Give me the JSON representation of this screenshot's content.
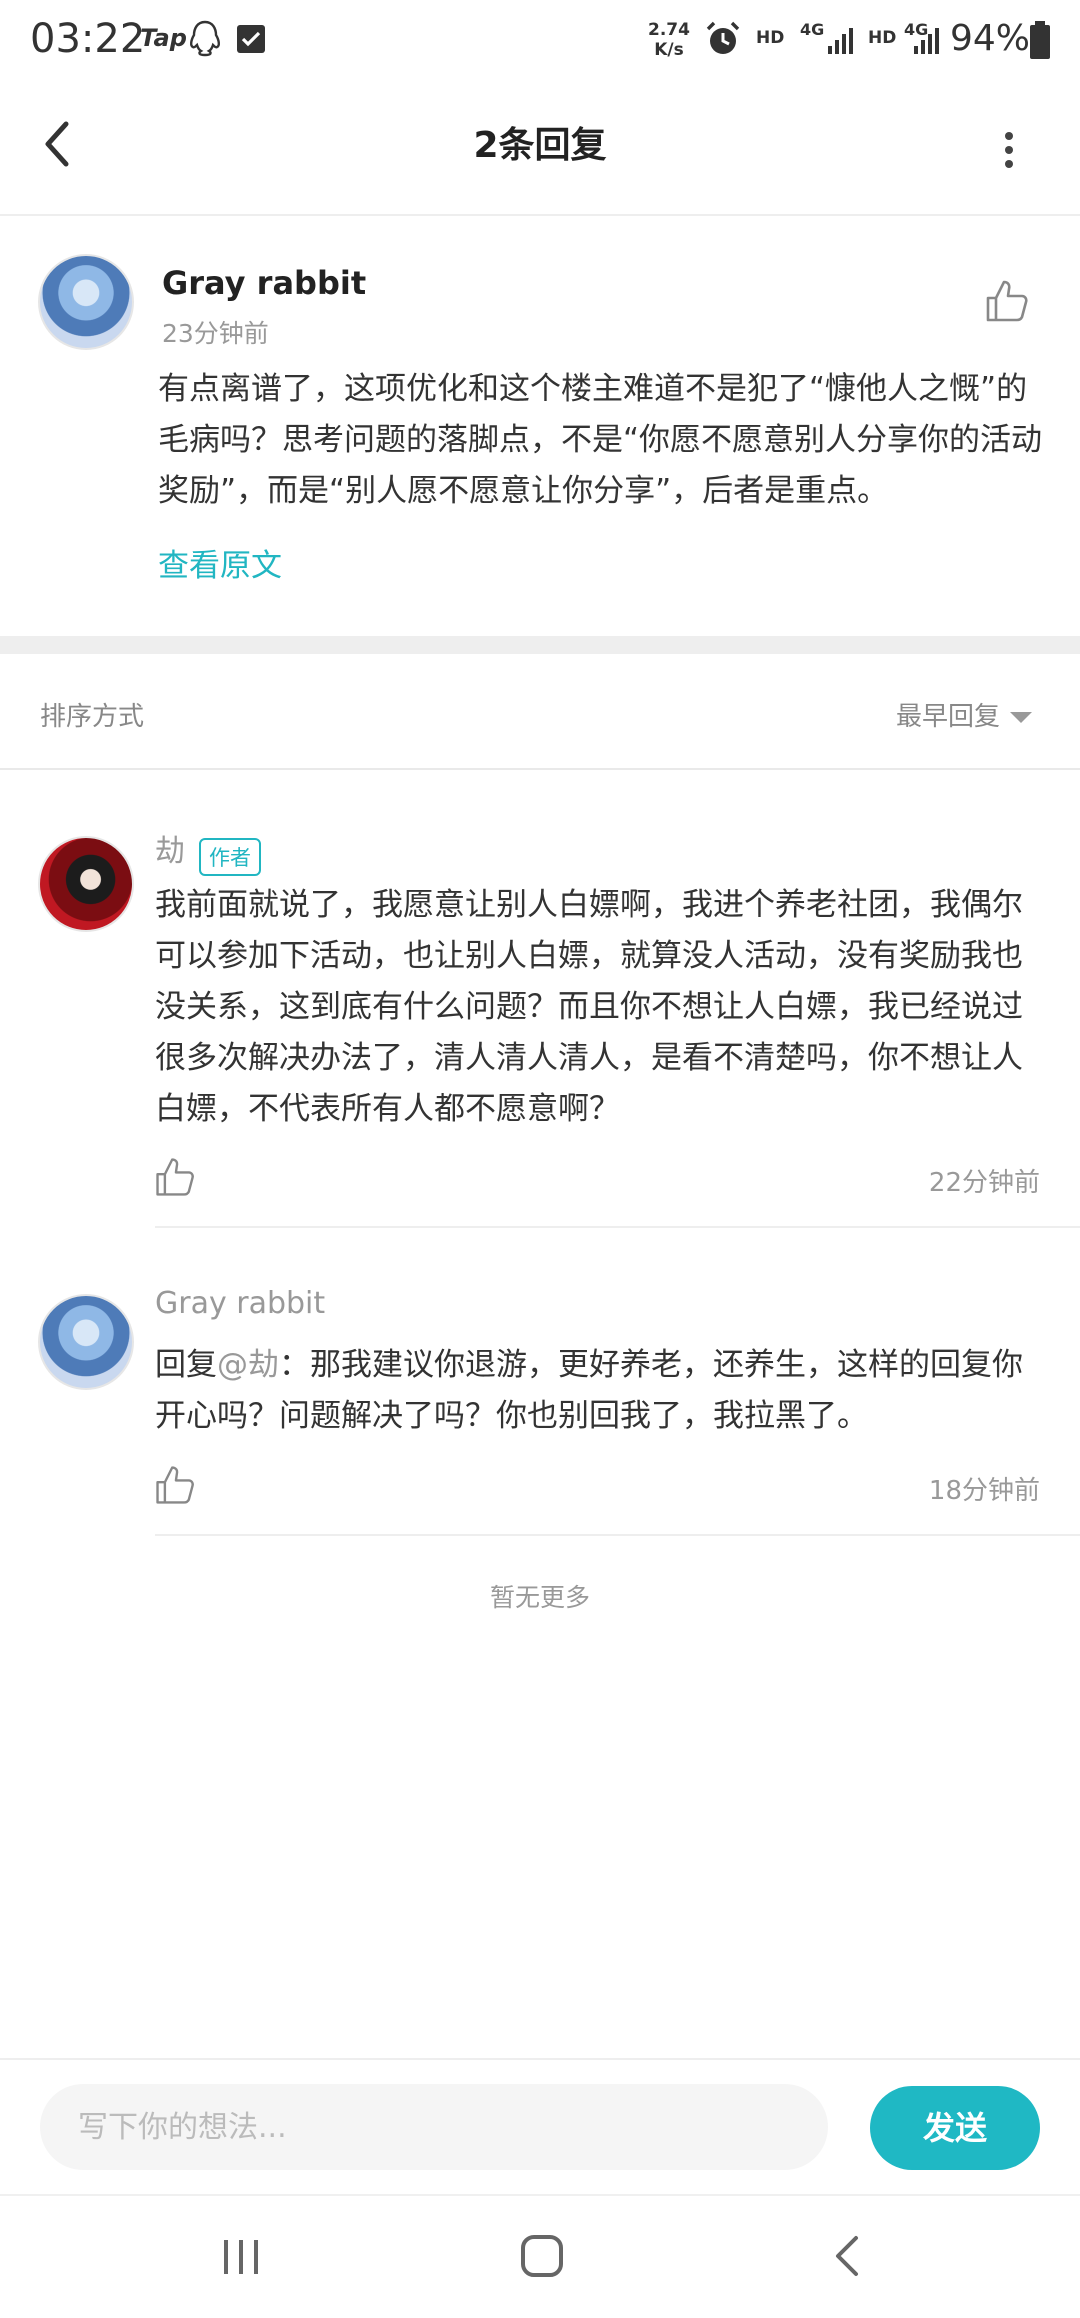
{
  "status_bar": {
    "time": "03:22",
    "app_label": "Tap",
    "net_speed_value": "2.74",
    "net_speed_unit": "K/s",
    "hd1": "HD",
    "net1": "4G",
    "hd2": "HD",
    "net2": "4G",
    "battery": "94%",
    "icons": [
      "qq-icon",
      "checkbox-icon",
      "alarm-icon",
      "signal-icon",
      "battery-icon"
    ]
  },
  "header": {
    "title": "2条回复"
  },
  "original_comment": {
    "author": "Gray rabbit",
    "time": "23分钟前",
    "text": "有点离谱了，这项优化和这个楼主难道不是犯了“慷他人之慨”的毛病吗？思考问题的落脚点，不是“你愿不愿意别人分享你的活动奖励”，而是“别人愿不愿意让你分享”，后者是重点。",
    "view_original": "查看原文"
  },
  "sort": {
    "label": "排序方式",
    "selected": "最早回复"
  },
  "replies": [
    {
      "author": "劫",
      "badge": "作者",
      "text": "我前面就说了，我愿意让别人白嫖啊，我进个养老社团，我偶尔可以参加下活动，也让别人白嫖，就算没人活动，没有奖励我也没关系，这到底有什么问题？而且你不想让人白嫖，我已经说过很多次解决办法了，清人清人清人，是看不清楚吗，你不想让人白嫖，不代表所有人都不愿意啊？",
      "time": "22分钟前"
    },
    {
      "author": "Gray rabbit",
      "reply_prefix": "回复",
      "mention": "@劫",
      "text": "：那我建议你退游，更好养老，还养生，这样的回复你开心吗？问题解决了吗？你也别回我了，我拉黑了。",
      "time": "18分钟前"
    }
  ],
  "no_more": "暂无更多",
  "input": {
    "placeholder": "写下你的想法...",
    "value": "",
    "send_label": "发送"
  },
  "colors": {
    "accent": "#1fb8c4",
    "link": "#21b6c2",
    "muted": "#999999"
  }
}
